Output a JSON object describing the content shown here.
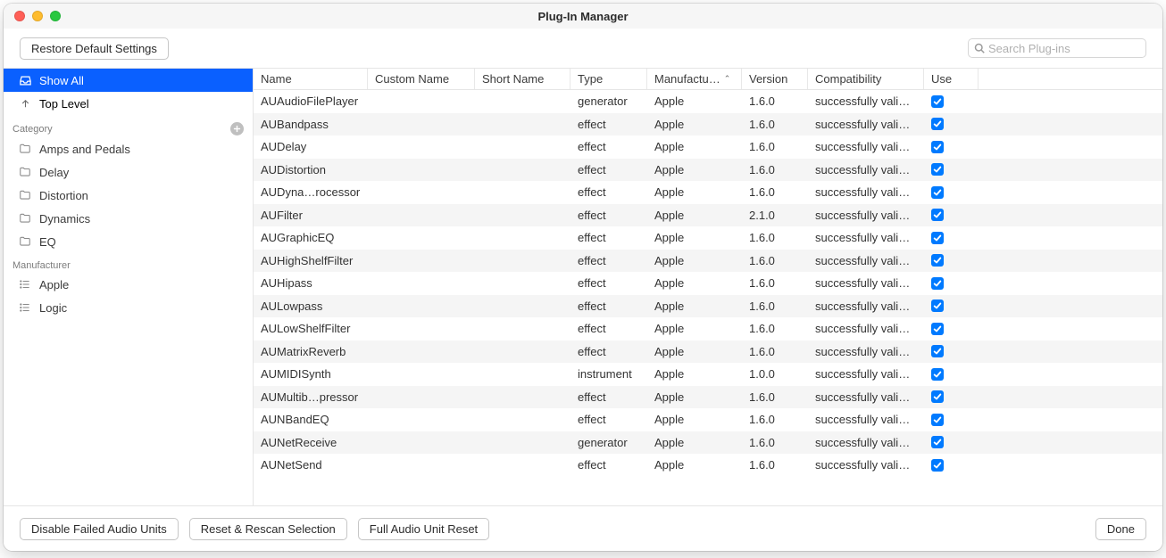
{
  "window": {
    "title": "Plug-In Manager"
  },
  "toolbar": {
    "restore_label": "Restore Default Settings",
    "search_placeholder": "Search Plug-ins"
  },
  "sidebar": {
    "show_all": "Show All",
    "top_level": "Top Level",
    "category_header": "Category",
    "categories": [
      "Amps and Pedals",
      "Delay",
      "Distortion",
      "Dynamics",
      "EQ"
    ],
    "manufacturer_header": "Manufacturer",
    "manufacturers": [
      "Apple",
      "Logic"
    ]
  },
  "table": {
    "columns": {
      "name": "Name",
      "custom_name": "Custom Name",
      "short_name": "Short Name",
      "type": "Type",
      "manufacturer": "Manufactu…",
      "version": "Version",
      "compatibility": "Compatibility",
      "use": "Use"
    },
    "rows": [
      {
        "name": "AUAudioFilePlayer",
        "type": "generator",
        "manufacturer": "Apple",
        "version": "1.6.0",
        "compat": "successfully vali…",
        "use": true
      },
      {
        "name": "AUBandpass",
        "type": "effect",
        "manufacturer": "Apple",
        "version": "1.6.0",
        "compat": "successfully vali…",
        "use": true
      },
      {
        "name": "AUDelay",
        "type": "effect",
        "manufacturer": "Apple",
        "version": "1.6.0",
        "compat": "successfully vali…",
        "use": true
      },
      {
        "name": "AUDistortion",
        "type": "effect",
        "manufacturer": "Apple",
        "version": "1.6.0",
        "compat": "successfully vali…",
        "use": true
      },
      {
        "name": "AUDyna…rocessor",
        "type": "effect",
        "manufacturer": "Apple",
        "version": "1.6.0",
        "compat": "successfully vali…",
        "use": true
      },
      {
        "name": "AUFilter",
        "type": "effect",
        "manufacturer": "Apple",
        "version": "2.1.0",
        "compat": "successfully vali…",
        "use": true
      },
      {
        "name": "AUGraphicEQ",
        "type": "effect",
        "manufacturer": "Apple",
        "version": "1.6.0",
        "compat": "successfully vali…",
        "use": true
      },
      {
        "name": "AUHighShelfFilter",
        "type": "effect",
        "manufacturer": "Apple",
        "version": "1.6.0",
        "compat": "successfully vali…",
        "use": true
      },
      {
        "name": "AUHipass",
        "type": "effect",
        "manufacturer": "Apple",
        "version": "1.6.0",
        "compat": "successfully vali…",
        "use": true
      },
      {
        "name": "AULowpass",
        "type": "effect",
        "manufacturer": "Apple",
        "version": "1.6.0",
        "compat": "successfully vali…",
        "use": true
      },
      {
        "name": "AULowShelfFilter",
        "type": "effect",
        "manufacturer": "Apple",
        "version": "1.6.0",
        "compat": "successfully vali…",
        "use": true
      },
      {
        "name": "AUMatrixReverb",
        "type": "effect",
        "manufacturer": "Apple",
        "version": "1.6.0",
        "compat": "successfully vali…",
        "use": true
      },
      {
        "name": "AUMIDISynth",
        "type": "instrument",
        "manufacturer": "Apple",
        "version": "1.0.0",
        "compat": "successfully vali…",
        "use": true
      },
      {
        "name": "AUMultib…pressor",
        "type": "effect",
        "manufacturer": "Apple",
        "version": "1.6.0",
        "compat": "successfully vali…",
        "use": true
      },
      {
        "name": "AUNBandEQ",
        "type": "effect",
        "manufacturer": "Apple",
        "version": "1.6.0",
        "compat": "successfully vali…",
        "use": true
      },
      {
        "name": "AUNetReceive",
        "type": "generator",
        "manufacturer": "Apple",
        "version": "1.6.0",
        "compat": "successfully vali…",
        "use": true
      },
      {
        "name": "AUNetSend",
        "type": "effect",
        "manufacturer": "Apple",
        "version": "1.6.0",
        "compat": "successfully vali…",
        "use": true
      }
    ]
  },
  "footer": {
    "disable_failed": "Disable Failed Audio Units",
    "reset_rescan": "Reset & Rescan Selection",
    "full_reset": "Full Audio Unit Reset",
    "done": "Done"
  }
}
